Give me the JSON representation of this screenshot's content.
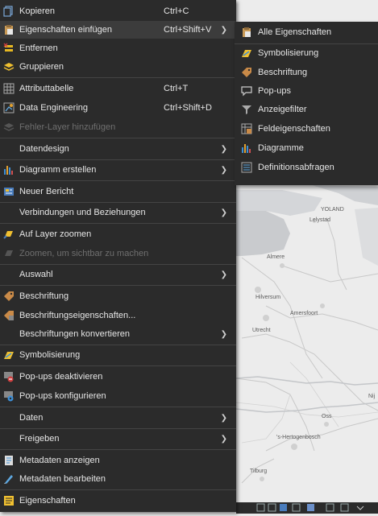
{
  "menu": {
    "copy": {
      "label": "Kopieren",
      "shortcut": "Ctrl+C"
    },
    "paste_props": {
      "label": "Eigenschaften einfügen",
      "shortcut": "Ctrl+Shift+V"
    },
    "remove": {
      "label": "Entfernen"
    },
    "group": {
      "label": "Gruppieren"
    },
    "attr_table": {
      "label": "Attributtabelle",
      "shortcut": "Ctrl+T"
    },
    "data_eng": {
      "label": "Data Engineering",
      "shortcut": "Ctrl+Shift+D"
    },
    "error_layer": {
      "label": "Fehler-Layer hinzufügen"
    },
    "data_design": {
      "label": "Datendesign"
    },
    "create_chart": {
      "label": "Diagramm erstellen"
    },
    "new_report": {
      "label": "Neuer Bericht"
    },
    "joins": {
      "label": "Verbindungen und Beziehungen"
    },
    "zoom_layer": {
      "label": "Auf Layer zoomen"
    },
    "zoom_visible": {
      "label": "Zoomen, um sichtbar zu machen"
    },
    "selection": {
      "label": "Auswahl"
    },
    "labeling": {
      "label": "Beschriftung"
    },
    "labeling_props": {
      "label": "Beschriftungseigenschaften..."
    },
    "convert_labels": {
      "label": "Beschriftungen konvertieren"
    },
    "symbology": {
      "label": "Symbolisierung"
    },
    "disable_popups": {
      "label": "Pop-ups deaktivieren"
    },
    "config_popups": {
      "label": "Pop-ups konfigurieren"
    },
    "data": {
      "label": "Daten"
    },
    "share": {
      "label": "Freigeben"
    },
    "view_metadata": {
      "label": "Metadaten anzeigen"
    },
    "edit_metadata": {
      "label": "Metadaten bearbeiten"
    },
    "properties": {
      "label": "Eigenschaften"
    }
  },
  "submenu": {
    "all_props": "Alle Eigenschaften",
    "symbology": "Symbolisierung",
    "labeling": "Beschriftung",
    "popups": "Pop-ups",
    "display_filter": "Anzeigefilter",
    "field_props": "Feldeigenschaften",
    "charts": "Diagramme",
    "def_queries": "Definitionsabfragen"
  },
  "map_labels": [
    "YOLAND",
    "Lelystad",
    "Almere",
    "Hilversum",
    "Amersfoort",
    "Utrecht",
    "Oss",
    "'s-Hertogenbosch",
    "Tilburg",
    "Nij"
  ],
  "colors": {
    "menu_bg": "#2b2b2b",
    "highlight": "#3c3c3c",
    "text": "#e6e6e6",
    "disabled": "#6f6f6f",
    "water": "#c7c9cc",
    "land": "#ececec"
  }
}
